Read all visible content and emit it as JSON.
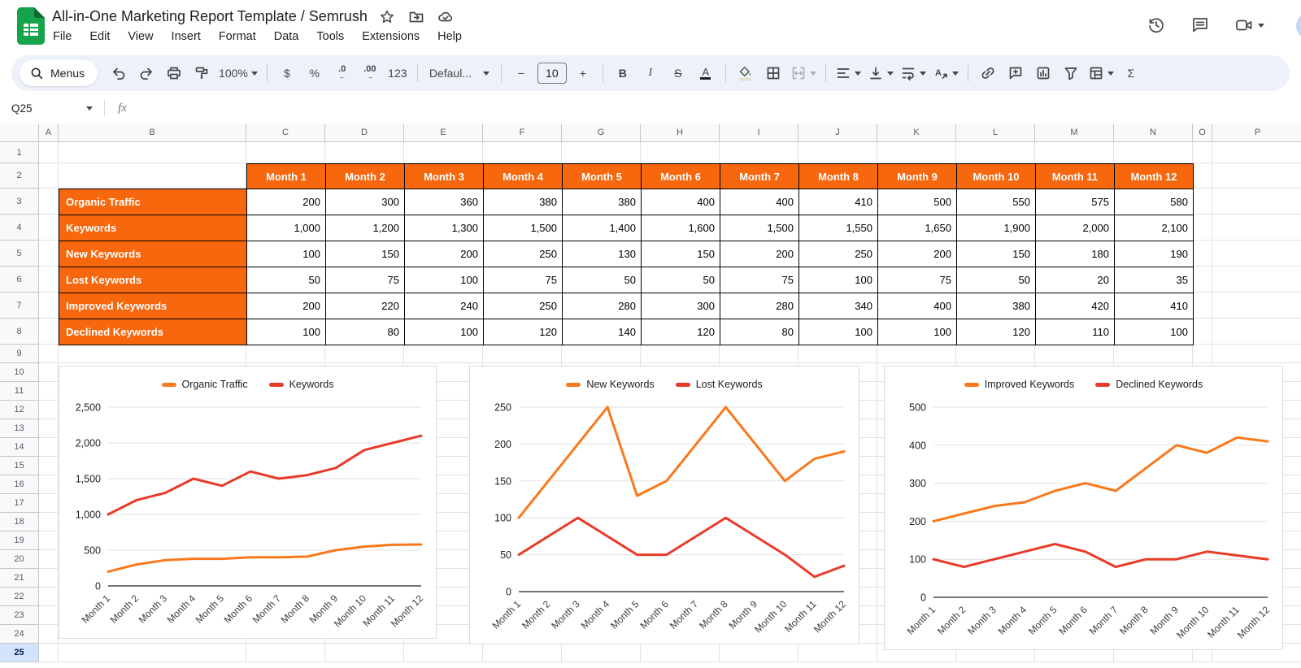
{
  "titlebar": {
    "title": "All-in-One Marketing Report Template / Semrush",
    "title_icons": [
      {
        "name": "star-icon"
      },
      {
        "name": "folder-move-icon"
      },
      {
        "name": "cloud-check-icon"
      }
    ],
    "menus": [
      "File",
      "Edit",
      "View",
      "Insert",
      "Format",
      "Data",
      "Tools",
      "Extensions",
      "Help"
    ],
    "right_icons": [
      {
        "name": "history-icon"
      },
      {
        "name": "comments-icon"
      },
      {
        "name": "video-call-icon",
        "caret": true
      }
    ]
  },
  "toolbar": {
    "items": [
      {
        "name": "menus-search",
        "icon": "search-icon",
        "label": "Menus",
        "pill": true
      },
      {
        "name": "undo",
        "icon": "undo-icon"
      },
      {
        "name": "redo",
        "icon": "redo-icon"
      },
      {
        "name": "print",
        "icon": "print-icon"
      },
      {
        "name": "paint-format",
        "icon": "paint-format-icon"
      },
      {
        "name": "zoom",
        "label": "100%",
        "caret": true
      },
      {
        "divider": true
      },
      {
        "name": "format-currency",
        "label": "$"
      },
      {
        "name": "format-percent",
        "label": "%"
      },
      {
        "name": "decrease-decimal",
        "icon": "decrease-decimal-icon"
      },
      {
        "name": "increase-decimal",
        "icon": "increase-decimal-icon"
      },
      {
        "name": "more-formats",
        "label": "123"
      },
      {
        "divider": true
      },
      {
        "name": "font-family",
        "label": "Defaul...",
        "caret": true,
        "wide": true
      },
      {
        "divider": true
      },
      {
        "name": "decrease-font-size",
        "label": "−"
      },
      {
        "name": "font-size",
        "label": "10",
        "box": true
      },
      {
        "name": "increase-font-size",
        "label": "+"
      },
      {
        "divider": true
      },
      {
        "name": "bold",
        "label": "B",
        "cls": "glyph-b"
      },
      {
        "name": "italic",
        "label": "I",
        "cls": "glyph-i"
      },
      {
        "name": "strikethrough",
        "label": "S",
        "cls": "glyph-s"
      },
      {
        "name": "text-color",
        "icon": "text-color-icon"
      },
      {
        "divider": true
      },
      {
        "name": "fill-color",
        "icon": "fill-color-icon"
      },
      {
        "name": "borders",
        "icon": "borders-icon"
      },
      {
        "name": "merge-cells",
        "icon": "merge-cells-icon",
        "caret": true,
        "disabled": true
      },
      {
        "divider": true
      },
      {
        "name": "horizontal-align",
        "icon": "align-left-icon",
        "caret": true
      },
      {
        "name": "vertical-align",
        "icon": "vertical-align-icon",
        "caret": true
      },
      {
        "name": "text-wrap",
        "icon": "text-wrap-icon",
        "caret": true
      },
      {
        "name": "text-rotation",
        "icon": "text-rotation-icon",
        "caret": true
      },
      {
        "divider": true
      },
      {
        "name": "insert-link",
        "icon": "link-icon"
      },
      {
        "name": "insert-comment",
        "icon": "comment-add-icon"
      },
      {
        "name": "insert-chart",
        "icon": "chart-icon"
      },
      {
        "name": "create-filter",
        "icon": "filter-icon"
      },
      {
        "name": "table-views",
        "icon": "table-views-icon",
        "caret": true
      },
      {
        "name": "functions",
        "label": "Σ"
      }
    ]
  },
  "formula_bar": {
    "name_box": "Q25",
    "fx_label": "fx"
  },
  "grid": {
    "columns": [
      "A",
      "B",
      "C",
      "D",
      "E",
      "F",
      "G",
      "H",
      "I",
      "J",
      "K",
      "L",
      "M",
      "N",
      "O",
      "P"
    ],
    "row_count": 25,
    "selected_row": 25
  },
  "table": {
    "column_headers": [
      "Month 1",
      "Month 2",
      "Month 3",
      "Month 4",
      "Month 5",
      "Month 6",
      "Month 7",
      "Month 8",
      "Month 9",
      "Month 10",
      "Month 11",
      "Month 12"
    ],
    "rows": [
      {
        "label": "Organic Traffic",
        "values": [
          "200",
          "300",
          "360",
          "380",
          "380",
          "400",
          "400",
          "410",
          "500",
          "550",
          "575",
          "580"
        ]
      },
      {
        "label": "Keywords",
        "values": [
          "1,000",
          "1,200",
          "1,300",
          "1,500",
          "1,400",
          "1,600",
          "1,500",
          "1,550",
          "1,650",
          "1,900",
          "2,000",
          "2,100"
        ]
      },
      {
        "label": "New Keywords",
        "values": [
          "100",
          "150",
          "200",
          "250",
          "130",
          "150",
          "200",
          "250",
          "200",
          "150",
          "180",
          "190"
        ]
      },
      {
        "label": "Lost Keywords",
        "values": [
          "50",
          "75",
          "100",
          "75",
          "50",
          "50",
          "75",
          "100",
          "75",
          "50",
          "20",
          "35"
        ]
      },
      {
        "label": "Improved Keywords",
        "values": [
          "200",
          "220",
          "240",
          "250",
          "280",
          "300",
          "280",
          "340",
          "400",
          "380",
          "420",
          "410"
        ]
      },
      {
        "label": "Declined Keywords",
        "values": [
          "100",
          "80",
          "100",
          "120",
          "140",
          "120",
          "80",
          "100",
          "100",
          "120",
          "110",
          "100"
        ]
      }
    ]
  },
  "chart_data": [
    {
      "type": "line",
      "categories": [
        "Month 1",
        "Month 2",
        "Month 3",
        "Month 4",
        "Month 5",
        "Month 6",
        "Month 7",
        "Month 8",
        "Month 9",
        "Month 10",
        "Month 11",
        "Month 12"
      ],
      "series": [
        {
          "name": "Organic Traffic",
          "color": "#F8791C",
          "values": [
            200,
            300,
            360,
            380,
            380,
            400,
            400,
            410,
            500,
            550,
            575,
            580
          ]
        },
        {
          "name": "Keywords",
          "color": "#E83B28",
          "values": [
            1000,
            1200,
            1300,
            1500,
            1400,
            1600,
            1500,
            1550,
            1650,
            1900,
            2000,
            2100
          ]
        }
      ],
      "title": "",
      "xlabel": "",
      "ylabel": "",
      "ylim": [
        0,
        2500
      ],
      "ytick_step": 500,
      "grid": true,
      "legend_position": "top"
    },
    {
      "type": "line",
      "categories": [
        "Month 1",
        "Month 2",
        "Month 3",
        "Month 4",
        "Month 5",
        "Month 6",
        "Month 7",
        "Month 8",
        "Month 9",
        "Month 10",
        "Month 11",
        "Month 12"
      ],
      "series": [
        {
          "name": "New Keywords",
          "color": "#F8791C",
          "values": [
            100,
            150,
            200,
            250,
            130,
            150,
            200,
            250,
            200,
            150,
            180,
            190
          ]
        },
        {
          "name": "Lost Keywords",
          "color": "#E83B28",
          "values": [
            50,
            75,
            100,
            75,
            50,
            50,
            75,
            100,
            75,
            50,
            20,
            35
          ]
        }
      ],
      "title": "",
      "xlabel": "",
      "ylabel": "",
      "ylim": [
        0,
        250
      ],
      "ytick_step": 50,
      "grid": true,
      "legend_position": "top"
    },
    {
      "type": "line",
      "categories": [
        "Month 1",
        "Month 2",
        "Month 3",
        "Month 4",
        "Month 5",
        "Month 6",
        "Month 7",
        "Month 8",
        "Month 9",
        "Month 10",
        "Month 11",
        "Month 12"
      ],
      "series": [
        {
          "name": "Improved Keywords",
          "color": "#F8791C",
          "values": [
            200,
            220,
            240,
            250,
            280,
            300,
            280,
            340,
            400,
            380,
            420,
            410
          ]
        },
        {
          "name": "Declined Keywords",
          "color": "#E83B28",
          "values": [
            100,
            80,
            100,
            120,
            140,
            120,
            80,
            100,
            100,
            120,
            110,
            100
          ]
        }
      ],
      "title": "",
      "xlabel": "",
      "ylabel": "",
      "ylim": [
        0,
        500
      ],
      "ytick_step": 100,
      "grid": true,
      "legend_position": "top"
    }
  ],
  "colors": {
    "table_orange": "#F6670E",
    "chart_orange": "#F8791C",
    "chart_red": "#E83B28",
    "toolbar_bg": "#edf2fa",
    "selected_row_bg": "#d3e3fd",
    "grid_line": "#e2e2e2"
  }
}
